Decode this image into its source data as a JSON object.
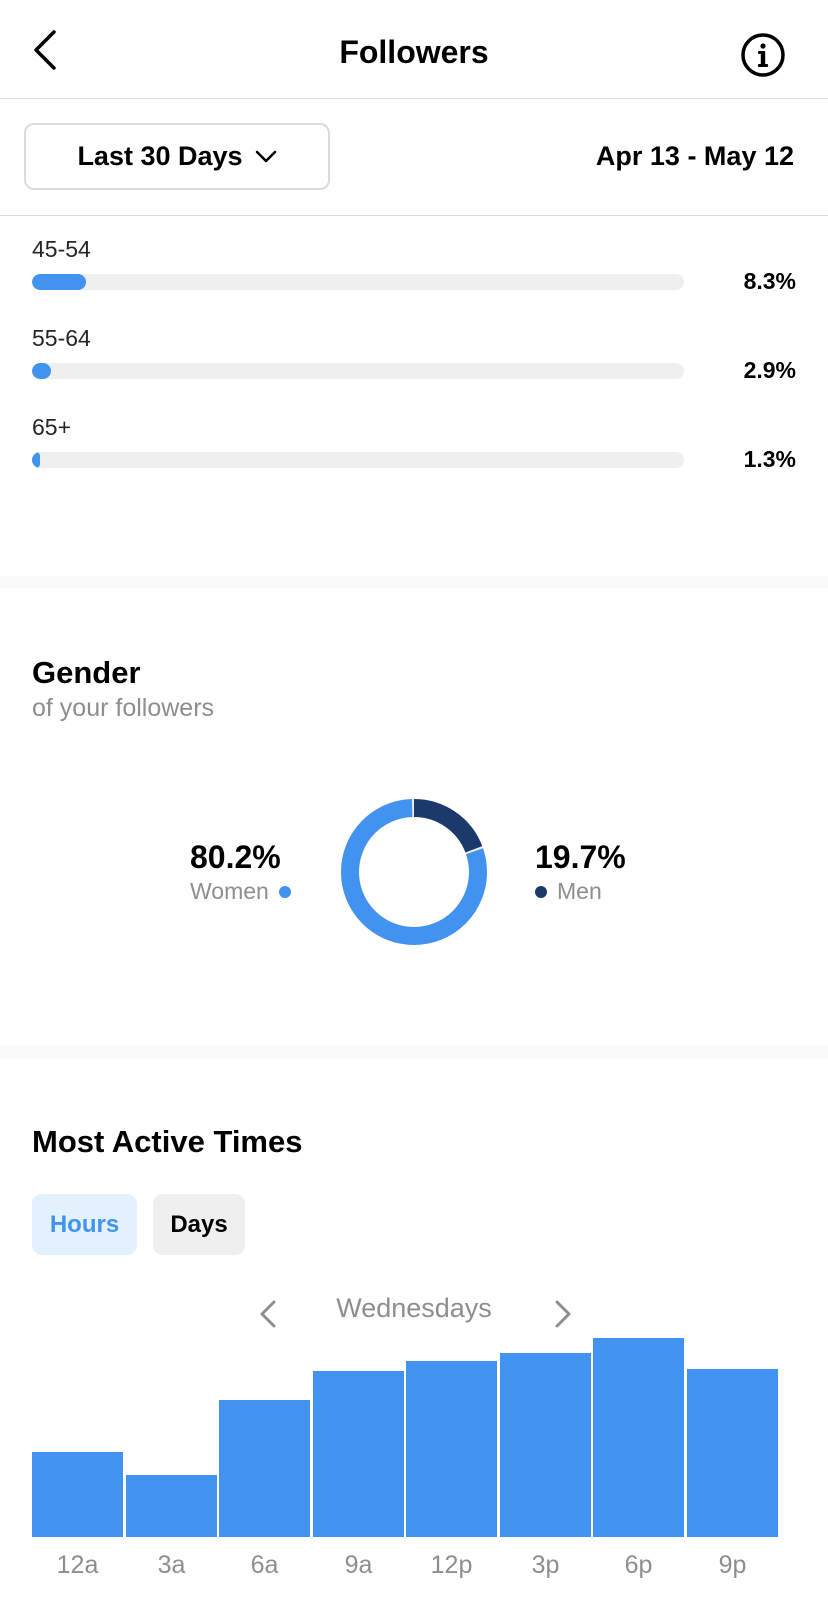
{
  "header": {
    "title": "Followers",
    "back_icon": "chevron-left-icon",
    "info_icon": "info-icon"
  },
  "filter": {
    "range_label": "Last 30 Days",
    "dropdown_icon": "chevron-down-icon",
    "date_range": "Apr 13 - May 12"
  },
  "age_ranges": [
    {
      "label": "45-54",
      "percent_text": "8.3%",
      "value": 8.3
    },
    {
      "label": "55-64",
      "percent_text": "2.9%",
      "value": 2.9
    },
    {
      "label": "65+",
      "percent_text": "1.3%",
      "value": 1.3
    }
  ],
  "gender": {
    "title": "Gender",
    "subtitle": "of your followers",
    "women": {
      "percent_text": "80.2%",
      "label": "Women",
      "value": 80.2,
      "color": "#4193ef"
    },
    "men": {
      "percent_text": "19.7%",
      "label": "Men",
      "value": 19.7,
      "color": "#1b3a6b"
    }
  },
  "active_times": {
    "title": "Most Active Times",
    "tabs": [
      {
        "label": "Hours",
        "selected": true
      },
      {
        "label": "Days",
        "selected": false
      }
    ],
    "day_label": "Wednesdays",
    "prev_icon": "chevron-left-icon",
    "next_icon": "chevron-right-icon"
  },
  "chart_data": {
    "type": "bar",
    "categories": [
      "12a",
      "3a",
      "6a",
      "9a",
      "12p",
      "3p",
      "6p",
      "9p"
    ],
    "values": [
      0.41,
      0.3,
      0.66,
      0.8,
      0.85,
      0.89,
      0.96,
      0.81
    ],
    "color": "#4193ef",
    "ylim": [
      0,
      1
    ]
  },
  "colors": {
    "accent": "#4193ef",
    "men": "#1b3a6b",
    "track": "#efefef",
    "muted_text": "#8e8e8e"
  }
}
